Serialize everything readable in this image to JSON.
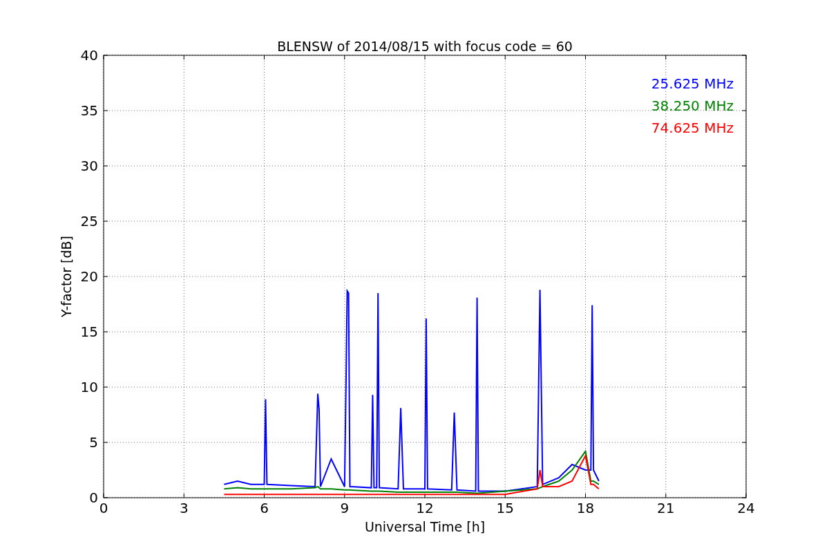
{
  "figure": {
    "chart_data": {
      "type": "line",
      "grid": true,
      "title": "BLENSW of 2014/08/15 with focus code = 60",
      "xlabel": "Universal Time [h]",
      "ylabel": "Y-factor [dB]",
      "xlim": [
        0,
        24
      ],
      "ylim": [
        0,
        40
      ],
      "xticks": [
        0,
        3,
        6,
        9,
        12,
        15,
        18,
        21,
        24
      ],
      "yticks": [
        0,
        5,
        10,
        15,
        20,
        25,
        30,
        35,
        40
      ],
      "x": [
        4.5,
        5.0,
        5.5,
        6.0,
        6.05,
        6.1,
        7.0,
        7.9,
        8.0,
        8.05,
        8.1,
        8.5,
        9.0,
        9.05,
        9.1,
        9.15,
        9.2,
        10.0,
        10.05,
        10.1,
        10.2,
        10.25,
        10.3,
        11.0,
        11.1,
        11.2,
        12.0,
        12.05,
        12.1,
        13.0,
        13.1,
        13.2,
        13.9,
        13.95,
        14.0,
        15.0,
        16.2,
        16.3,
        16.4,
        17.0,
        17.5,
        18.0,
        18.2,
        18.25,
        18.3,
        18.5
      ],
      "series": [
        {
          "name": "25.625 MHz",
          "color": "#0000ff",
          "values": [
            1.2,
            1.5,
            1.2,
            1.2,
            8.9,
            1.2,
            1.1,
            1.0,
            9.4,
            8.0,
            1.0,
            3.5,
            1.0,
            9.6,
            18.7,
            18.5,
            1.0,
            0.9,
            9.3,
            0.9,
            0.9,
            18.5,
            0.9,
            0.8,
            8.1,
            0.8,
            0.8,
            16.2,
            0.8,
            0.7,
            7.7,
            0.7,
            0.6,
            18.1,
            0.6,
            0.6,
            1.0,
            18.8,
            1.2,
            1.8,
            3.0,
            2.5,
            2.5,
            17.4,
            2.5,
            1.5
          ]
        },
        {
          "name": "38.250 MHz",
          "color": "#008000",
          "values": [
            0.8,
            0.9,
            0.8,
            0.8,
            0.8,
            0.8,
            0.8,
            0.9,
            1.0,
            0.9,
            0.8,
            0.8,
            0.7,
            0.7,
            0.7,
            0.7,
            0.7,
            0.6,
            0.6,
            0.6,
            0.6,
            0.6,
            0.6,
            0.5,
            0.5,
            0.5,
            0.5,
            0.5,
            0.5,
            0.5,
            0.5,
            0.5,
            0.4,
            0.4,
            0.4,
            0.6,
            0.8,
            0.9,
            1.0,
            1.5,
            2.5,
            4.2,
            1.5,
            1.5,
            1.5,
            1.2
          ]
        },
        {
          "name": "74.625 MHz",
          "color": "#ff0000",
          "values": [
            0.3,
            0.3,
            0.3,
            0.3,
            0.3,
            0.3,
            0.3,
            0.3,
            0.3,
            0.3,
            0.3,
            0.3,
            0.3,
            0.3,
            0.3,
            0.3,
            0.3,
            0.3,
            0.3,
            0.3,
            0.3,
            0.3,
            0.3,
            0.3,
            0.3,
            0.3,
            0.3,
            0.3,
            0.3,
            0.3,
            0.3,
            0.3,
            0.3,
            0.3,
            0.3,
            0.3,
            0.8,
            2.5,
            1.0,
            1.0,
            1.5,
            3.8,
            1.2,
            1.2,
            1.2,
            0.8
          ]
        }
      ]
    }
  }
}
